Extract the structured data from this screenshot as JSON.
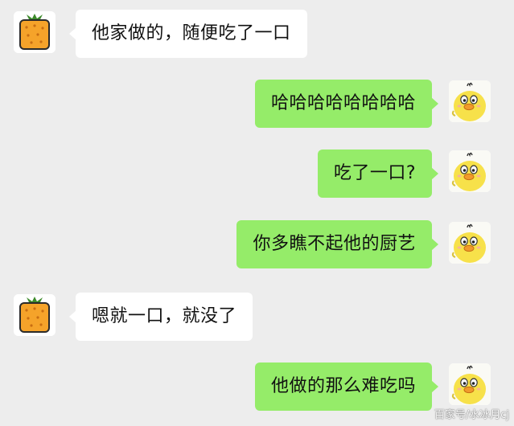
{
  "colors": {
    "background": "#ededed",
    "incoming_bubble": "#ffffff",
    "outgoing_bubble": "#95ec69"
  },
  "messages": [
    {
      "side": "left",
      "text": "他家做的，随便吃了一口",
      "avatar": "orange-gift-box-icon"
    },
    {
      "side": "right",
      "text": "哈哈哈哈哈哈哈哈",
      "avatar": "yellow-duck-icon"
    },
    {
      "side": "right",
      "text": "吃了一口?",
      "avatar": "yellow-duck-icon"
    },
    {
      "side": "right",
      "text": "你多瞧不起他的厨艺",
      "avatar": "yellow-duck-icon"
    },
    {
      "side": "left",
      "text": "嗯就一口，就没了",
      "avatar": "orange-gift-box-icon"
    },
    {
      "side": "right",
      "text": "他做的那么难吃吗",
      "avatar": "yellow-duck-icon"
    }
  ],
  "watermark": "百家号/水冰月cj"
}
